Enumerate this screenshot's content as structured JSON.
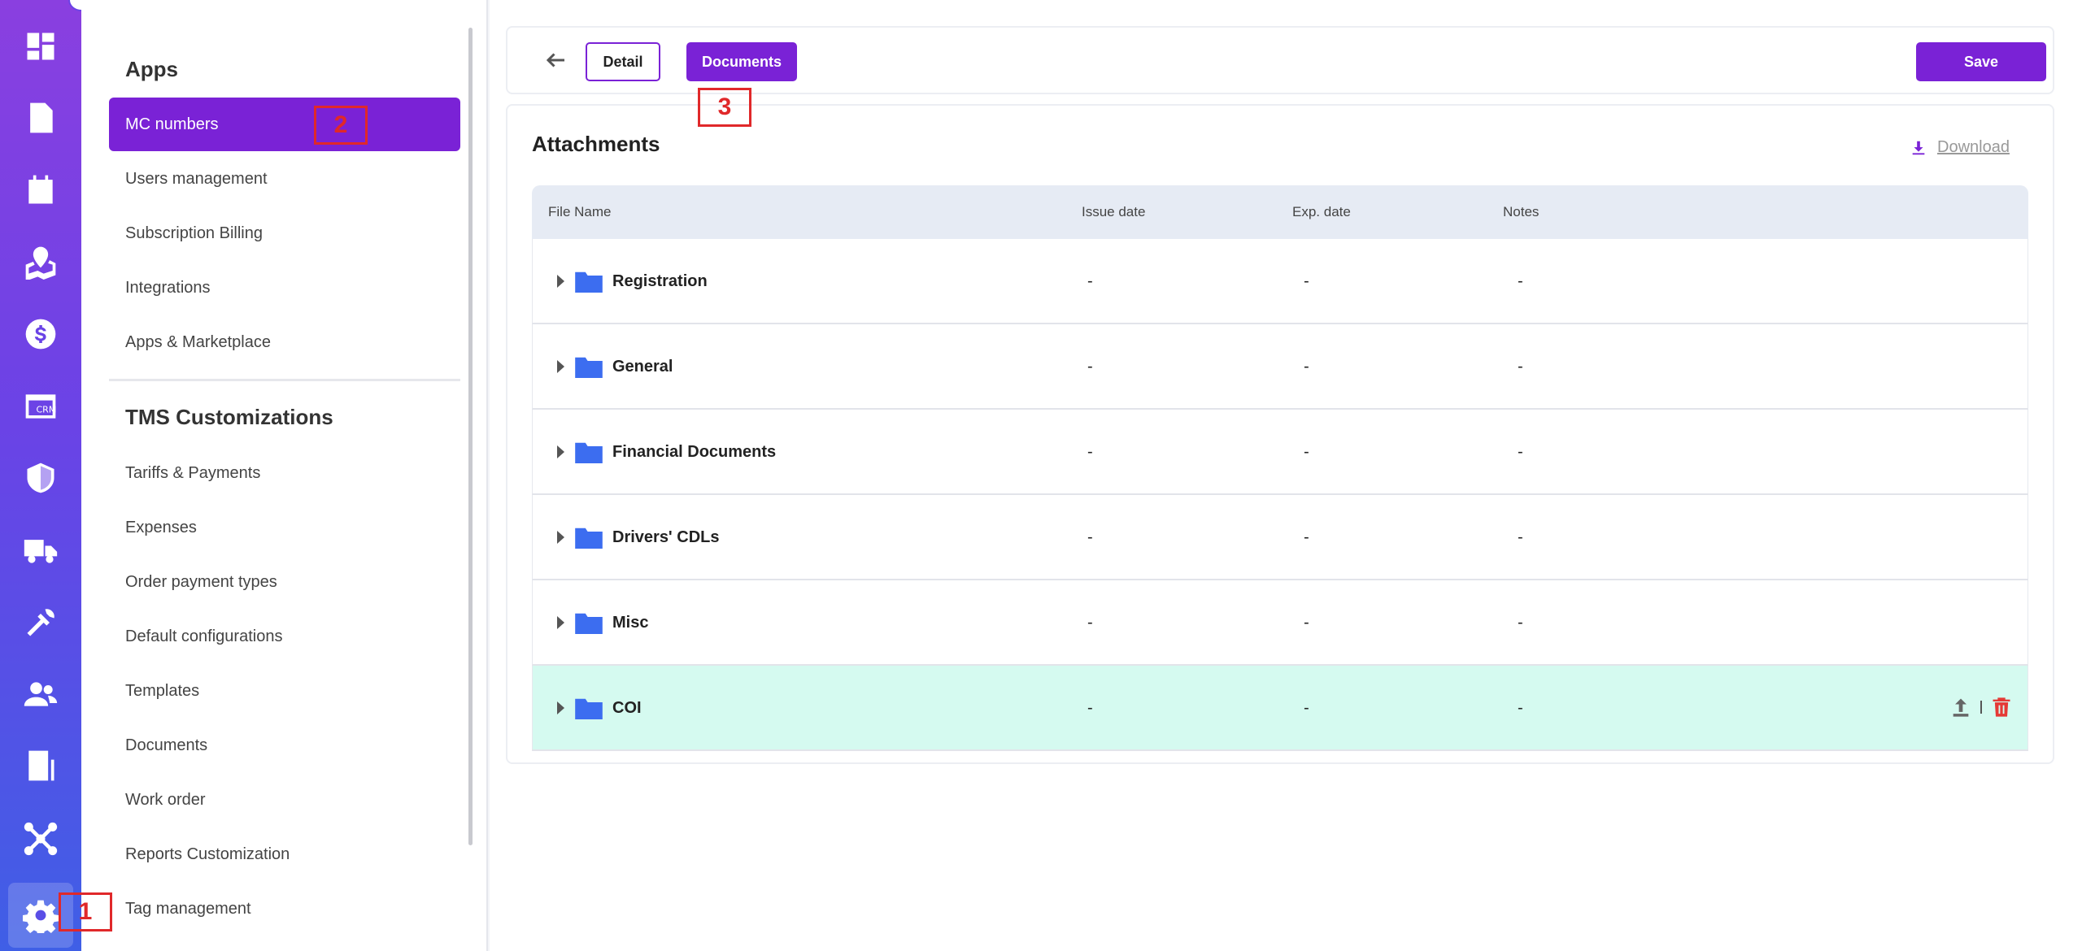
{
  "rail": {
    "icons": [
      "dashboard-icon",
      "document-icon",
      "calendar-icon",
      "map-icon",
      "dollar-icon",
      "crm-icon",
      "shield-icon",
      "truck-icon",
      "tools-icon",
      "users-icon",
      "report-icon",
      "network-icon",
      "settings-icon"
    ],
    "crm_label": "CRM"
  },
  "menu": {
    "apps_heading": "Apps",
    "apps_items": [
      "MC numbers",
      "Users management",
      "Subscription Billing",
      "Integrations",
      "Apps & Marketplace"
    ],
    "tms_heading": "TMS Customizations",
    "tms_items": [
      "Tariffs & Payments",
      "Expenses",
      "Order payment types",
      "Default configurations",
      "Templates",
      "Documents",
      "Work order",
      "Reports Customization",
      "Tag management"
    ]
  },
  "toolbar": {
    "detail_label": "Detail",
    "documents_label": "Documents",
    "save_label": "Save"
  },
  "attachments": {
    "title": "Attachments",
    "download_label": "Download",
    "columns": [
      "File Name",
      "Issue date",
      "Exp. date",
      "Notes"
    ],
    "rows": [
      {
        "name": "Registration",
        "issue": "-",
        "exp": "-",
        "notes": "-"
      },
      {
        "name": "General",
        "issue": "-",
        "exp": "-",
        "notes": "-"
      },
      {
        "name": "Financial Documents",
        "issue": "-",
        "exp": "-",
        "notes": "-"
      },
      {
        "name": "Drivers' CDLs",
        "issue": "-",
        "exp": "-",
        "notes": "-"
      },
      {
        "name": "Misc",
        "issue": "-",
        "exp": "-",
        "notes": "-"
      },
      {
        "name": "COI",
        "issue": "-",
        "exp": "-",
        "notes": "-"
      }
    ]
  },
  "annotations": [
    "1",
    "2",
    "3"
  ],
  "colors": {
    "accent": "#7a22d6",
    "highlight_row": "#d5faf0",
    "folder": "#3c6df0",
    "annotation": "#e0282a",
    "delete": "#e53935"
  }
}
